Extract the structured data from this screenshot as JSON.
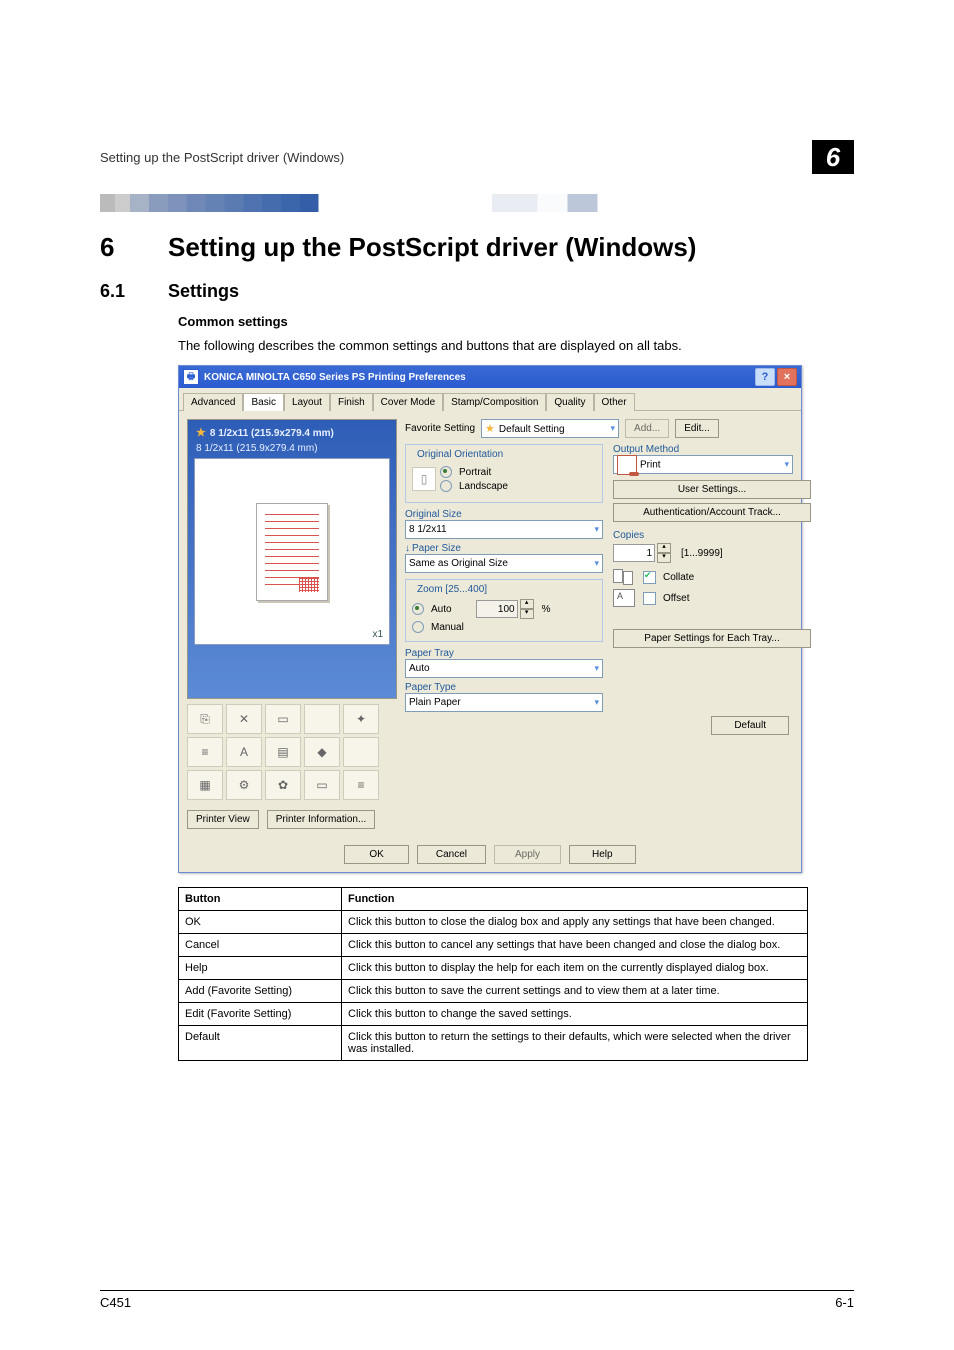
{
  "header": {
    "breadcrumb": "Setting up the PostScript driver (Windows)",
    "chapter_badge": "6"
  },
  "title": {
    "number": "6",
    "text": "Setting up the PostScript driver (Windows)"
  },
  "section": {
    "number": "6.1",
    "text": "Settings"
  },
  "subhead": "Common settings",
  "body": "The following describes the common settings and buttons that are displayed on all tabs.",
  "screenshot": {
    "window_title": "KONICA MINOLTA C650 Series PS Printing Preferences",
    "help_btn": "?",
    "close_btn": "×",
    "tabs": [
      "Advanced",
      "Basic",
      "Layout",
      "Finish",
      "Cover Mode",
      "Stamp/Composition",
      "Quality",
      "Other"
    ],
    "active_tab_index": 1,
    "preview": {
      "top_label": "8 1/2x11 (215.9x279.4 mm)",
      "bottom_label": "8 1/2x11 (215.9x279.4 mm)",
      "zoom_label": "x1",
      "printer_view": "Printer View",
      "printer_info": "Printer Information..."
    },
    "favorite": {
      "label": "Favorite Setting",
      "value": "Default Setting",
      "add": "Add...",
      "edit": "Edit..."
    },
    "left": {
      "orientation_legend": "Original Orientation",
      "portrait": "Portrait",
      "landscape": "Landscape",
      "original_size_label": "Original Size",
      "original_size_value": "8 1/2x11",
      "paper_size_label": "Paper Size",
      "paper_size_value": "Same as Original Size",
      "zoom_legend": "Zoom [25...400]",
      "zoom_auto": "Auto",
      "zoom_manual": "Manual",
      "zoom_value": "100",
      "zoom_unit": "%",
      "paper_tray_label": "Paper Tray",
      "paper_tray_value": "Auto",
      "paper_type_label": "Paper Type",
      "paper_type_value": "Plain Paper"
    },
    "right": {
      "output_method_label": "Output Method",
      "output_method_value": "Print",
      "user_settings": "User Settings...",
      "auth_track": "Authentication/Account Track...",
      "copies_label": "Copies",
      "copies_value": "1",
      "copies_range": "[1...9999]",
      "collate": "Collate",
      "offset": "Offset",
      "paper_settings_tray": "Paper Settings for Each Tray..."
    },
    "default_btn": "Default",
    "footer": {
      "ok": "OK",
      "cancel": "Cancel",
      "apply": "Apply",
      "help": "Help"
    }
  },
  "table": {
    "head_button": "Button",
    "head_function": "Function",
    "rows": [
      {
        "button": "OK",
        "function": "Click this button to close the dialog box and apply any settings that have been changed."
      },
      {
        "button": "Cancel",
        "function": "Click this button to cancel any settings that have been changed and close the dialog box."
      },
      {
        "button": "Help",
        "function": "Click this button to display the help for each item on the currently displayed dialog box."
      },
      {
        "button": "Add (Favorite Setting)",
        "function": "Click this button to save the current settings and to view them at a later time."
      },
      {
        "button": "Edit (Favorite Setting)",
        "function": "Click this button to change the saved settings."
      },
      {
        "button": "Default",
        "function": "Click this button to return the settings to their defaults, which were selected when the driver was installed."
      }
    ]
  },
  "footer": {
    "left": "C451",
    "right": "6-1"
  }
}
